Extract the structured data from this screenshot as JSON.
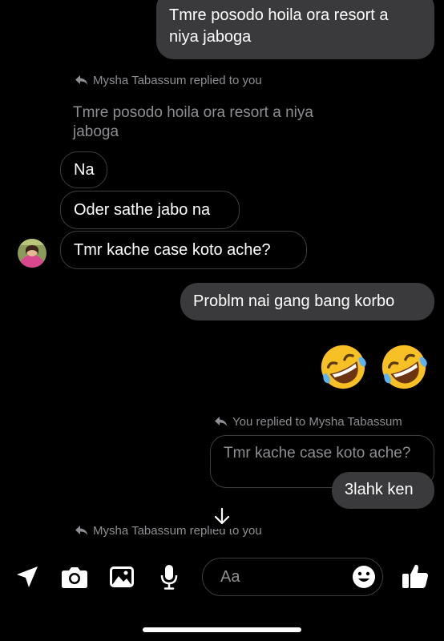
{
  "messages": {
    "out_1": "Tmre posodo hoila ora resort a niya jaboga",
    "reply_label_1": "Mysha Tabassum replied to you",
    "quoted_1": "Tmre posodo hoila ora resort a niya jaboga",
    "in_1": "Na",
    "in_2": "Oder sathe jabo na",
    "in_3": "Tmr kache case koto ache?",
    "out_2": "Problm nai gang bang korbo",
    "reply_label_2": "You replied to Mysha Tabassum",
    "quoted_2": "Tmr kache case koto ache?",
    "out_3": "3lahk ken",
    "reply_label_3": "Mysha Tabassum replied to you"
  },
  "emojis": [
    "rolling-on-floor-laughing",
    "rolling-on-floor-laughing"
  ],
  "composer": {
    "placeholder": "Aa"
  },
  "colors": {
    "background": "#000000",
    "outgoing_bubble": "#3a3a3c",
    "muted_text": "#8e8e93",
    "incoming_border": "#3e3e40",
    "emoji_yellow": "#f7c025"
  },
  "icons": [
    "location-arrow-icon",
    "camera-icon",
    "image-icon",
    "microphone-icon",
    "emoji-icon",
    "thumbs-up-icon",
    "scroll-down-arrow-icon"
  ]
}
